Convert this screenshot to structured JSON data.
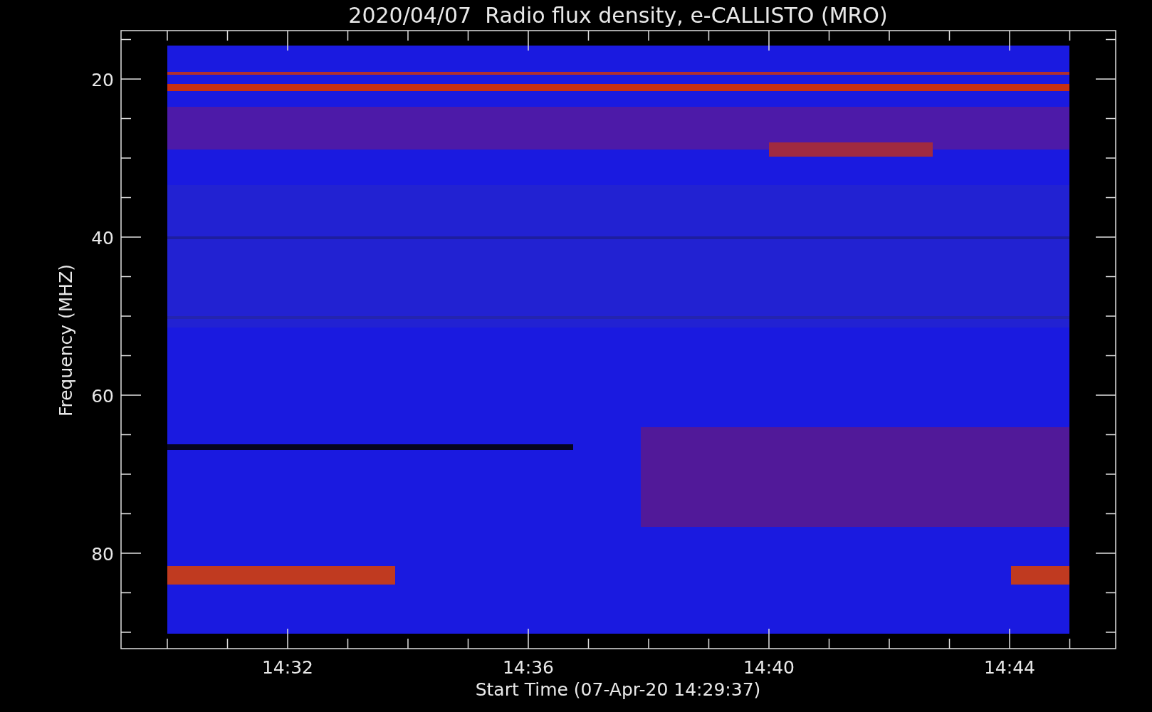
{
  "title": "2020/04/07  Radio flux density, e-CALLISTO (MRO)",
  "y_axis": {
    "label": "Frequency (MHZ)",
    "ticks": [
      "20",
      "40",
      "60",
      "80"
    ]
  },
  "x_axis": {
    "label": "Start Time (07-Apr-20 14:29:37)",
    "ticks": [
      "14:32",
      "14:36",
      "14:40",
      "14:44"
    ]
  }
}
